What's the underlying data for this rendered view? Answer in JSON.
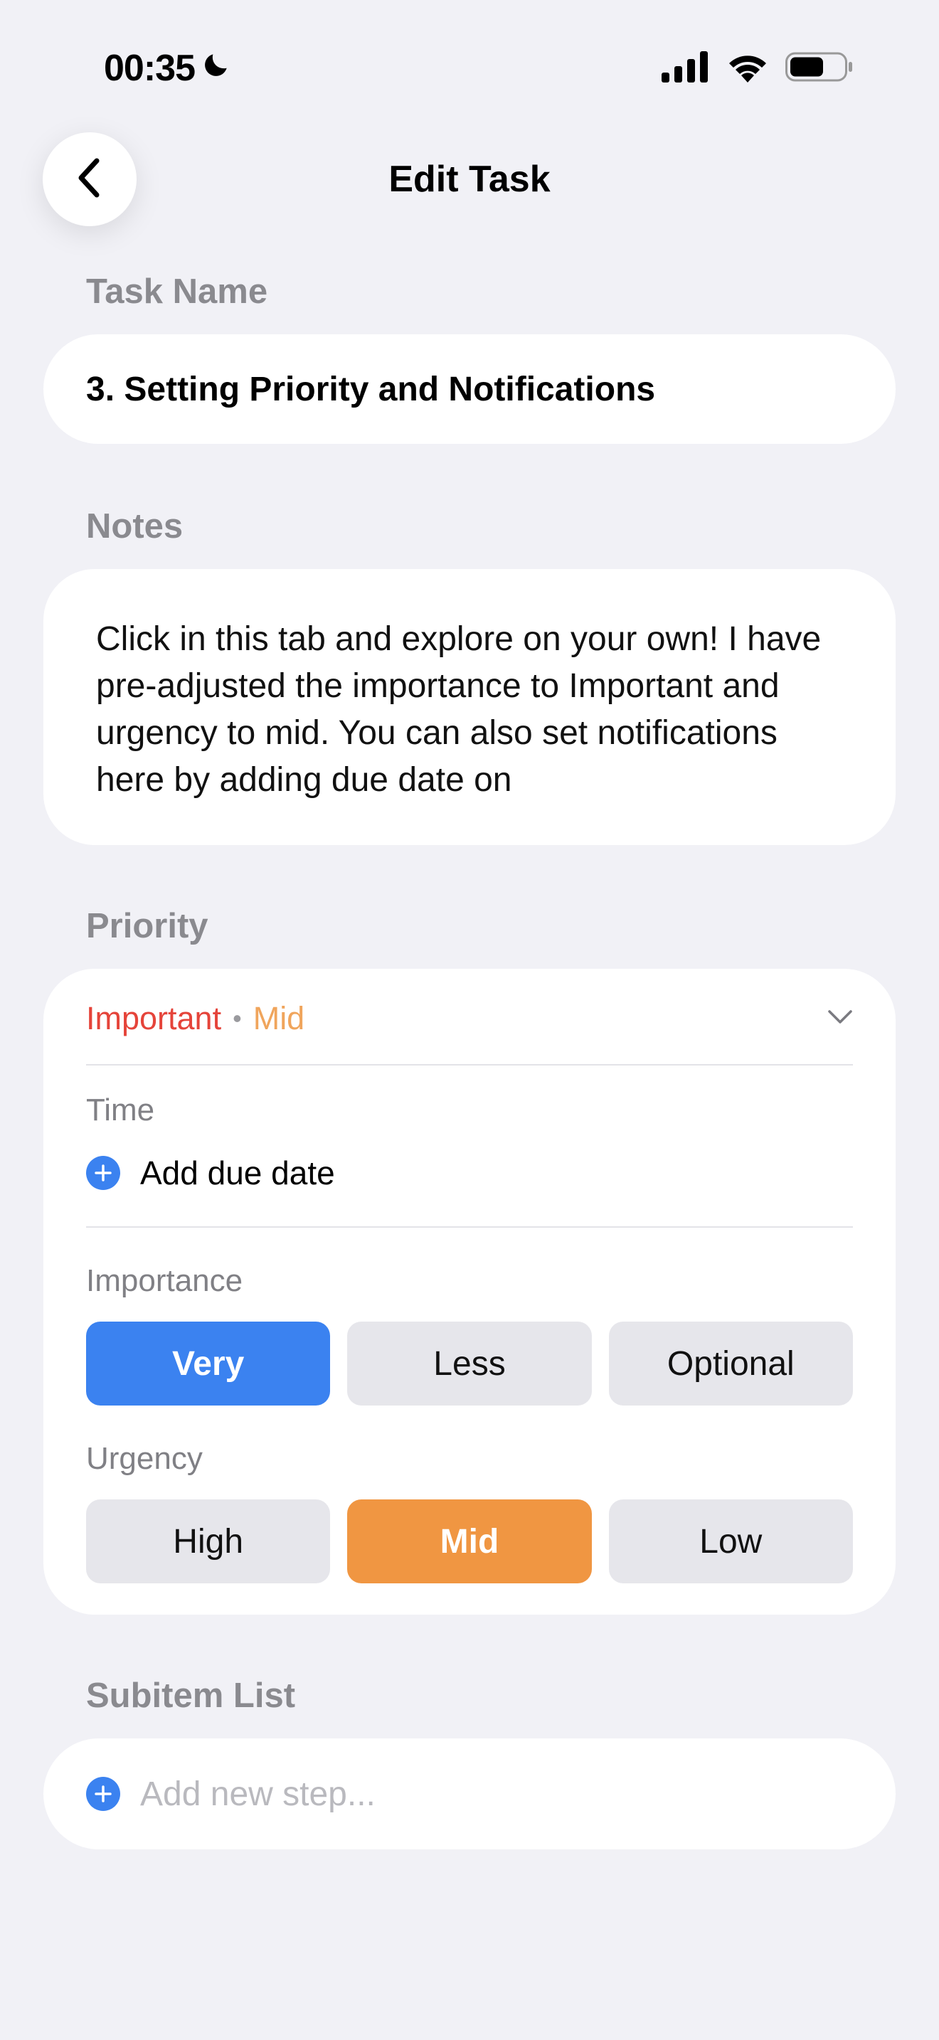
{
  "status_bar": {
    "time": "00:35",
    "icons": [
      "moon-icon",
      "signal-icon",
      "wifi-icon",
      "battery-icon"
    ]
  },
  "nav": {
    "back_icon": "chevron-left-icon",
    "title": "Edit Task"
  },
  "task_name": {
    "label": "Task Name",
    "value": "3. Setting Priority and Notifications"
  },
  "notes": {
    "label": "Notes",
    "value": "Click in this tab and explore on your own! I have pre-adjusted the importance to Important and urgency to mid. You can also set notifications here by adding due date on"
  },
  "priority": {
    "label": "Priority",
    "summary_importance": "Important",
    "summary_separator": "•",
    "summary_urgency": "Mid",
    "time_label": "Time",
    "add_due_date": "Add due date",
    "importance_label": "Importance",
    "importance_options": [
      "Very",
      "Less",
      "Optional"
    ],
    "importance_selected": "Very",
    "urgency_label": "Urgency",
    "urgency_options": [
      "High",
      "Mid",
      "Low"
    ],
    "urgency_selected": "Mid"
  },
  "subitems": {
    "label": "Subitem List",
    "placeholder": "Add new step..."
  },
  "colors": {
    "background": "#f1f1f6",
    "accent_blue": "#3b82f0",
    "accent_orange": "#f09642",
    "important_red": "#e5443a",
    "mid_orange": "#f0a55c"
  }
}
